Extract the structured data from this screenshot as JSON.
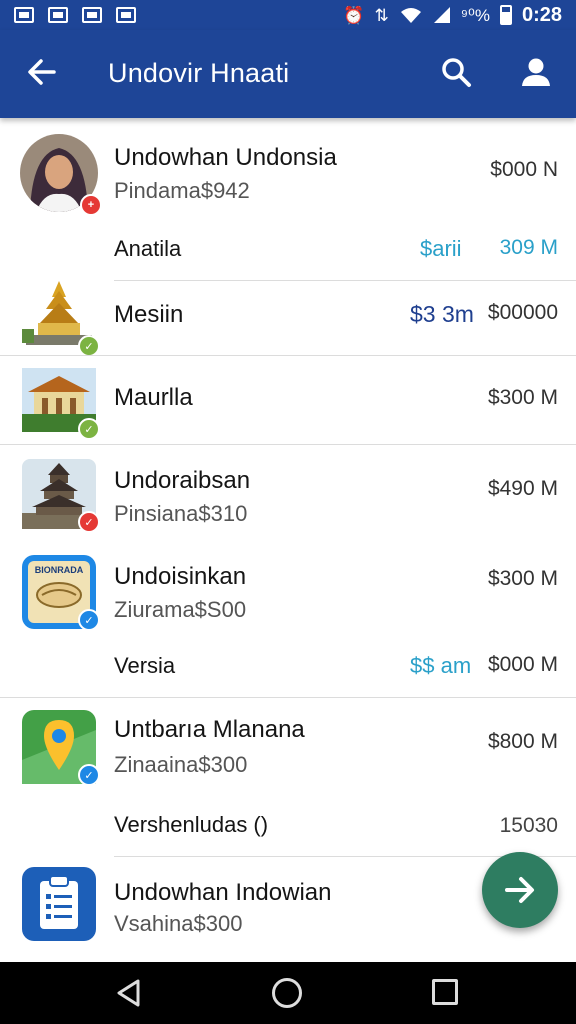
{
  "status_bar": {
    "signal_text": "⁹⁰%",
    "time": "0:28"
  },
  "app_bar": {
    "title": "Undovir Hnaati"
  },
  "items": [
    {
      "title": "Undowhan Undonsia",
      "subtitle": "Pindama$942",
      "price": "$000 N",
      "badge_color": "#e53935",
      "badge_glyph": "+"
    },
    {
      "label": "Anatila",
      "accent": "$arii",
      "price": "309 M"
    },
    {
      "title": "Mesiin",
      "accent": "$3 3m",
      "price": "$00000",
      "badge_color": "#7cb342",
      "badge_glyph": "✓"
    },
    {
      "title": "Maurlla",
      "price": "$300 M",
      "badge_color": "#7cb342",
      "badge_glyph": "✓"
    },
    {
      "title": "Undoraibsan",
      "subtitle": "Pinsiana$310",
      "price": "$490 M",
      "badge_color": "#e53935",
      "badge_glyph": "✓"
    },
    {
      "title": "Undoisinkan",
      "subtitle": "Ziurama$S00",
      "price": "$300 M",
      "badge_color": "#1e88e5",
      "badge_glyph": "✓",
      "thumb_text": "BIONRADA"
    },
    {
      "label": "Versia",
      "accent": "$$ am",
      "price": "$000 M"
    },
    {
      "title": "Untbarıa Mlanana",
      "subtitle": "Zinaaina$300",
      "price": "$800 M",
      "badge_color": "#1e88e5",
      "badge_glyph": "✓"
    },
    {
      "label": "Vershenludas ()",
      "price": "15030"
    },
    {
      "title": "Undowhan Indowian",
      "subtitle": "Vsahina$300"
    }
  ],
  "colors": {
    "primary": "#1e4597",
    "accent_teal": "#2aa0c9",
    "accent_navy": "#1f3f8f",
    "fab": "#2e7d61"
  },
  "icons": {
    "back": "arrow-left-icon",
    "search": "search-icon",
    "account": "person-icon",
    "fab": "arrow-right-icon"
  }
}
